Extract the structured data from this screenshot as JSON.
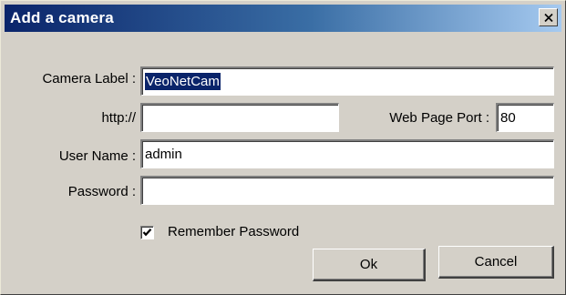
{
  "window": {
    "title": "Add a camera",
    "close_glyph": "✕"
  },
  "form": {
    "camera_label": {
      "label": "Camera Label :",
      "value": "VeoNetCam"
    },
    "http": {
      "label": "http://",
      "value": ""
    },
    "web_port": {
      "label": "Web Page Port :",
      "value": "80"
    },
    "user_name": {
      "label": "User Name :",
      "value": "admin"
    },
    "password": {
      "label": "Password :",
      "value": ""
    },
    "remember": {
      "label": "Remember Password",
      "checked": true
    }
  },
  "buttons": {
    "ok_label": "Ok",
    "cancel_label": "Cancel"
  },
  "colors": {
    "title_gradient_start": "#0a246a",
    "title_gradient_end": "#a6caf0",
    "selection": "#0a246a",
    "face": "#d4d0c8"
  }
}
